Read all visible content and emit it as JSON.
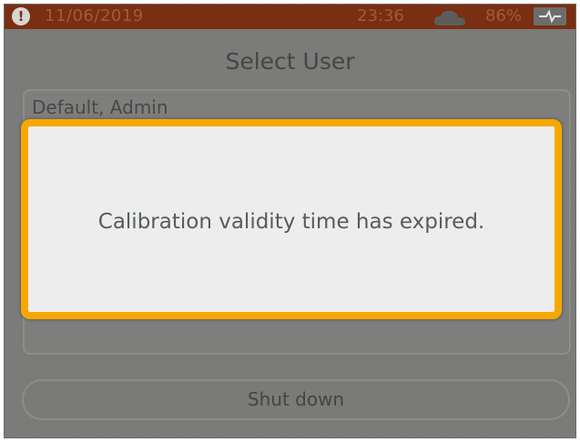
{
  "status_bar": {
    "date": "11/06/2019",
    "time": "23:36",
    "battery": "86%",
    "icons": [
      "alert-icon",
      "cloud-icon",
      "power-plug-icon"
    ]
  },
  "screen": {
    "title": "Select User",
    "users": [
      "Default, Admin"
    ],
    "shutdown_label": "Shut down"
  },
  "dialog": {
    "message": "Calibration validity time has expired."
  },
  "colors": {
    "status_bar_bg": "#7a2e12",
    "dialog_border": "#f6a800",
    "dialog_bg": "#ededed",
    "overlay_bg": "#7b7b79"
  }
}
